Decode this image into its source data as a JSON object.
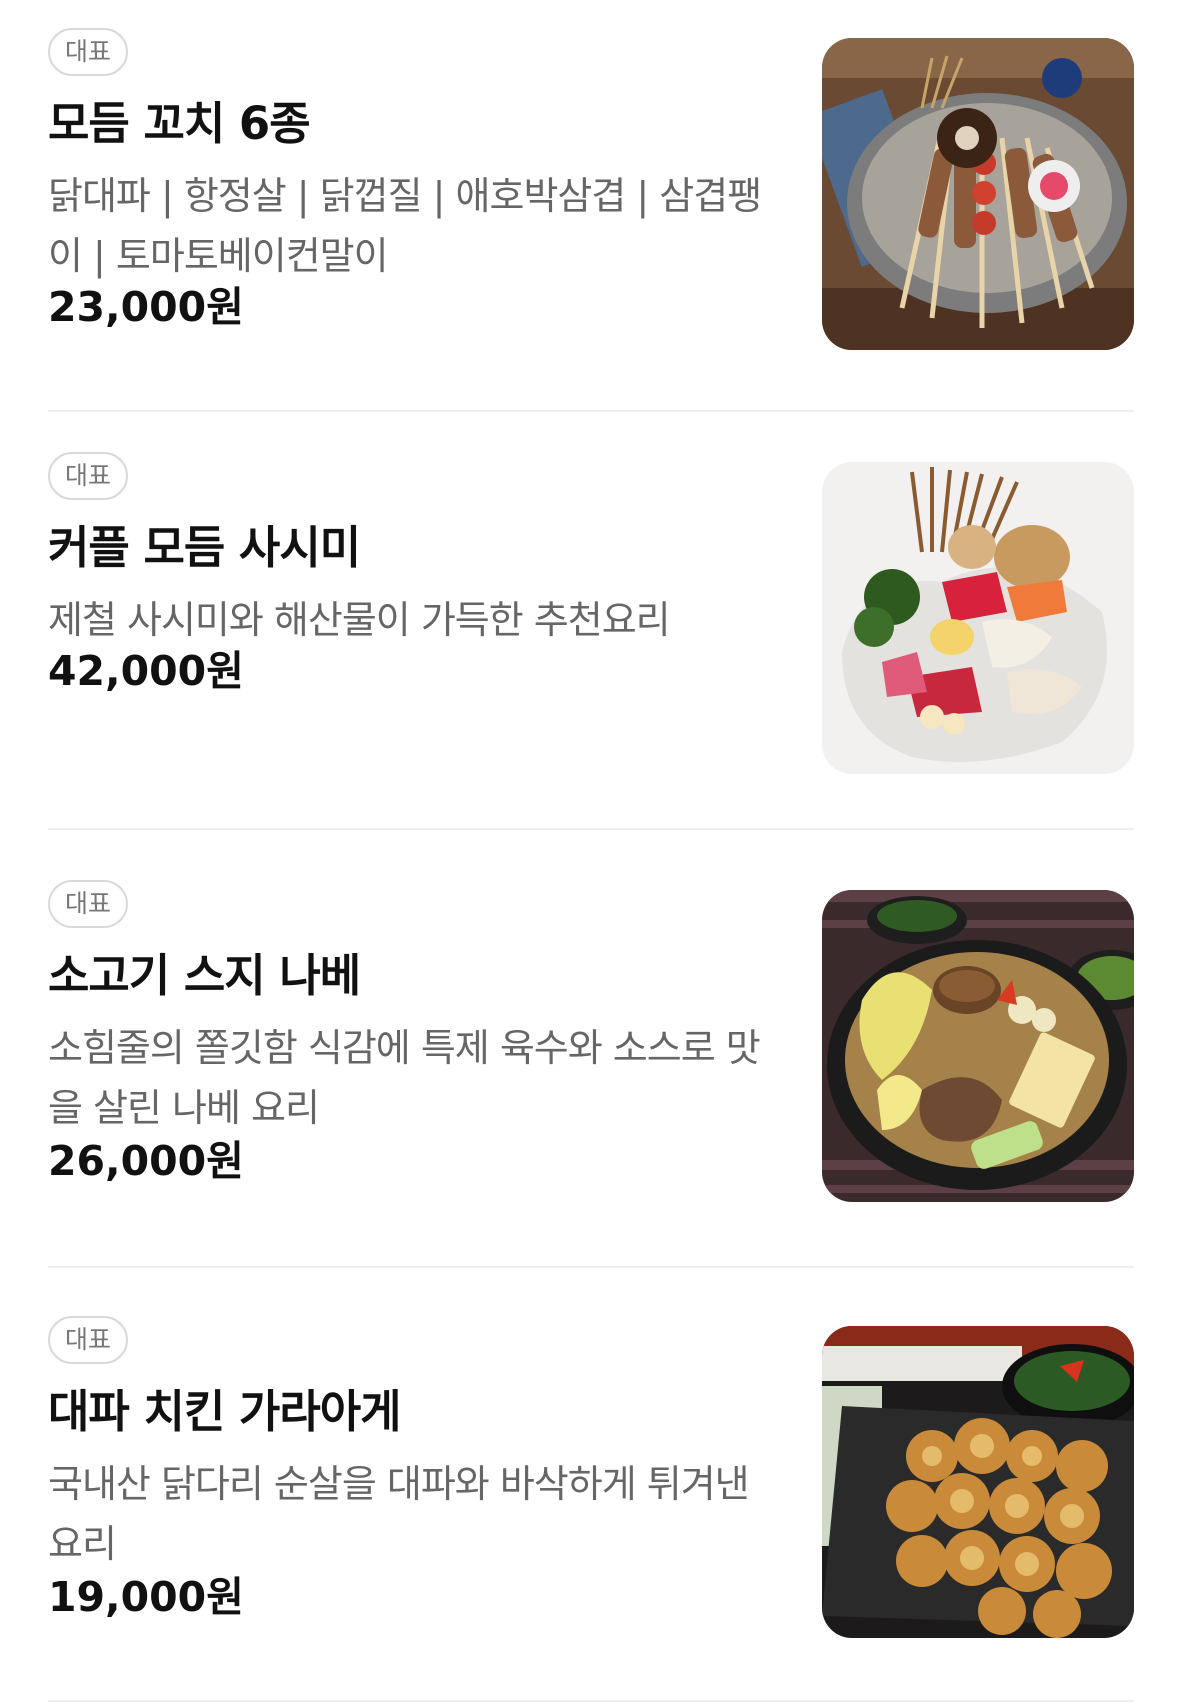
{
  "menu": {
    "items": [
      {
        "badge": "대표",
        "name": "모듬 꼬치 6종",
        "description": "닭대파 | 항정살 | 닭껍질 | 애호박삼겹 | 삼겹팽이 | 토마토베이컨말이",
        "price": "23,000원",
        "image_icon": "skewer-platter-photo"
      },
      {
        "badge": "대표",
        "name": "커플 모듬 사시미",
        "description": "제철 사시미와 해산물이 가득한 추천요리",
        "price": "42,000원",
        "image_icon": "sashimi-platter-photo"
      },
      {
        "badge": "대표",
        "name": "소고기 스지 나베",
        "description": "소힘줄의 쫄깃함 식감에 특제 육수와 소스로 맛을 살린 나베 요리",
        "price": "26,000원",
        "image_icon": "beef-nabe-hotpot-photo"
      },
      {
        "badge": "대표",
        "name": "대파 치킨 가라아게",
        "description": "국내산 닭다리 순살을 대파와 바삭하게 튀겨낸 요리",
        "price": "19,000원",
        "image_icon": "fried-chicken-karaage-photo"
      }
    ]
  },
  "colors": {
    "text_primary": "#111111",
    "text_secondary": "#666666",
    "badge_border": "#d9d9d9",
    "divider": "#efefef"
  }
}
